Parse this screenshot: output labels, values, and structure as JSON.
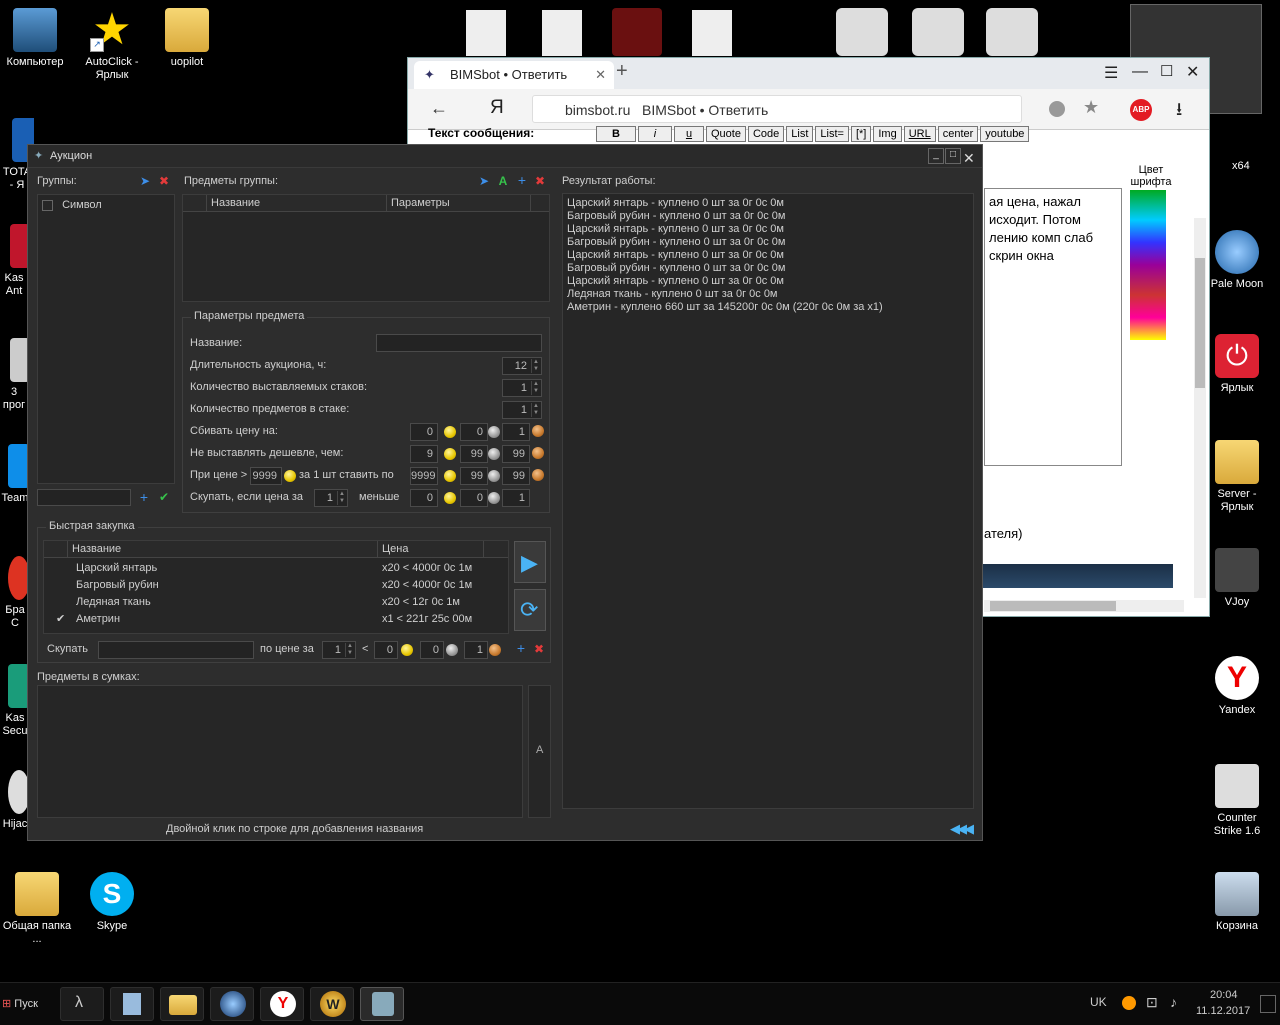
{
  "desktop": {
    "icons_left": [
      {
        "label": "Компьютер"
      },
      {
        "label": "AutoClick - Ярлык"
      },
      {
        "label": "uopilot"
      },
      {
        "label": "TOTA - Я"
      },
      {
        "label": "Kas Ant"
      },
      {
        "label": "3 прог"
      },
      {
        "label": "Team"
      },
      {
        "label": "Бра С"
      },
      {
        "label": "Kas Secu"
      },
      {
        "label": "Hijac"
      },
      {
        "label": "Общая папка ..."
      },
      {
        "label": "Skype"
      }
    ],
    "icons_right": [
      {
        "label": "Pale Moon"
      },
      {
        "label": "Ярлык"
      },
      {
        "label": "Server - Ярлык"
      },
      {
        "label": "VJoy"
      },
      {
        "label": "Yandex"
      },
      {
        "label": "Counter Strike 1.6"
      },
      {
        "label": "Корзина"
      }
    ],
    "right_partial": "x64"
  },
  "browser": {
    "tab_title": "BIMSbot • Ответить",
    "url_domain": "bimsbot.ru",
    "url_title": "BIMSbot • Ответить",
    "yandex_glyph": "Я",
    "abp_label": "ABP",
    "message_label": "Текст сообщения:",
    "format_buttons": [
      "B",
      "i",
      "u",
      "Quote",
      "Code",
      "List",
      "List=",
      "[*]",
      "Img",
      "URL",
      "center",
      "youtube"
    ],
    "font_color_label": "Цвет шрифта",
    "text_lines": [
      "ая цена, нажал",
      "исходит. Потом",
      "лению комп слаб",
      "скрин окна"
    ],
    "partial_text": "ателя)"
  },
  "auction": {
    "title": "Аукцион",
    "groups_label": "Группы:",
    "group_items": [
      "Символ"
    ],
    "group_items_label": "Предметы группы:",
    "items_table_headers": [
      "Название",
      "Параметры"
    ],
    "result_label": "Результат работы:",
    "log_lines": [
      "Царский янтарь - куплено 0 шт за 0г 0с 0м",
      "Багровый рубин - куплено 0 шт за 0г 0с 0м",
      "Царский янтарь - куплено 0 шт за 0г 0с 0м",
      "Багровый рубин - куплено 0 шт за 0г 0с 0м",
      "Царский янтарь - куплено 0 шт за 0г 0с 0м",
      "Багровый рубин - куплено 0 шт за 0г 0с 0м",
      "Царский янтарь - куплено 0 шт за 0г 0с 0м",
      "Ледяная ткань - куплено 0 шт за 0г 0с 0м",
      "Аметрин - куплено 660 шт за 145200г 0с 0м (220г 0с 0м за x1)"
    ],
    "params": {
      "title": "Параметры предмета",
      "name_label": "Название:",
      "duration_label": "Длительность аукциона, ч:",
      "duration": "12",
      "stacks_label": "Количество выставляемых стаков:",
      "stacks": "1",
      "per_stack_label": "Количество предметов в стаке:",
      "per_stack": "1",
      "undercut_label": "Сбивать цену на:",
      "undercut": [
        "0",
        "0",
        "1"
      ],
      "min_label": "Не выставлять дешевле, чем:",
      "min": [
        "9",
        "99",
        "99"
      ],
      "if_price_label": "При цене >",
      "if_price_value": "9999",
      "per_one_label": "за 1 шт ставить по",
      "set_price": [
        "9999",
        "99",
        "99"
      ],
      "buy_if_label": "Скупать, если цена за",
      "buy_if_qty": "1",
      "less_label": "меньше",
      "buy_if_price": [
        "0",
        "0",
        "1"
      ]
    },
    "quick": {
      "title": "Быстрая закупка",
      "headers": [
        "Название",
        "Цена"
      ],
      "rows": [
        {
          "check": "",
          "name": "Царский янтарь",
          "price": "x20 < 4000г 0с 1м"
        },
        {
          "check": "",
          "name": "Багровый рубин",
          "price": "x20 < 4000г 0с 1м"
        },
        {
          "check": "",
          "name": "Ледяная ткань",
          "price": "x20 < 12г 0с 1м"
        },
        {
          "check": "✔",
          "name": "Аметрин",
          "price": "x1 < 221г 25с 00м"
        }
      ],
      "buy_label": "Скупать",
      "at_price_label": "по цене за",
      "qty": "1",
      "lt": "<",
      "price": [
        "0",
        "0",
        "1"
      ]
    },
    "bags_label": "Предметы в сумках:",
    "bags_side_label": "A",
    "status_hint": "Двойной клик по строке для добавления названия"
  },
  "taskbar": {
    "start_label": "Пуск",
    "lang": "UK",
    "time": "20:04",
    "date": "11.12.2017"
  }
}
